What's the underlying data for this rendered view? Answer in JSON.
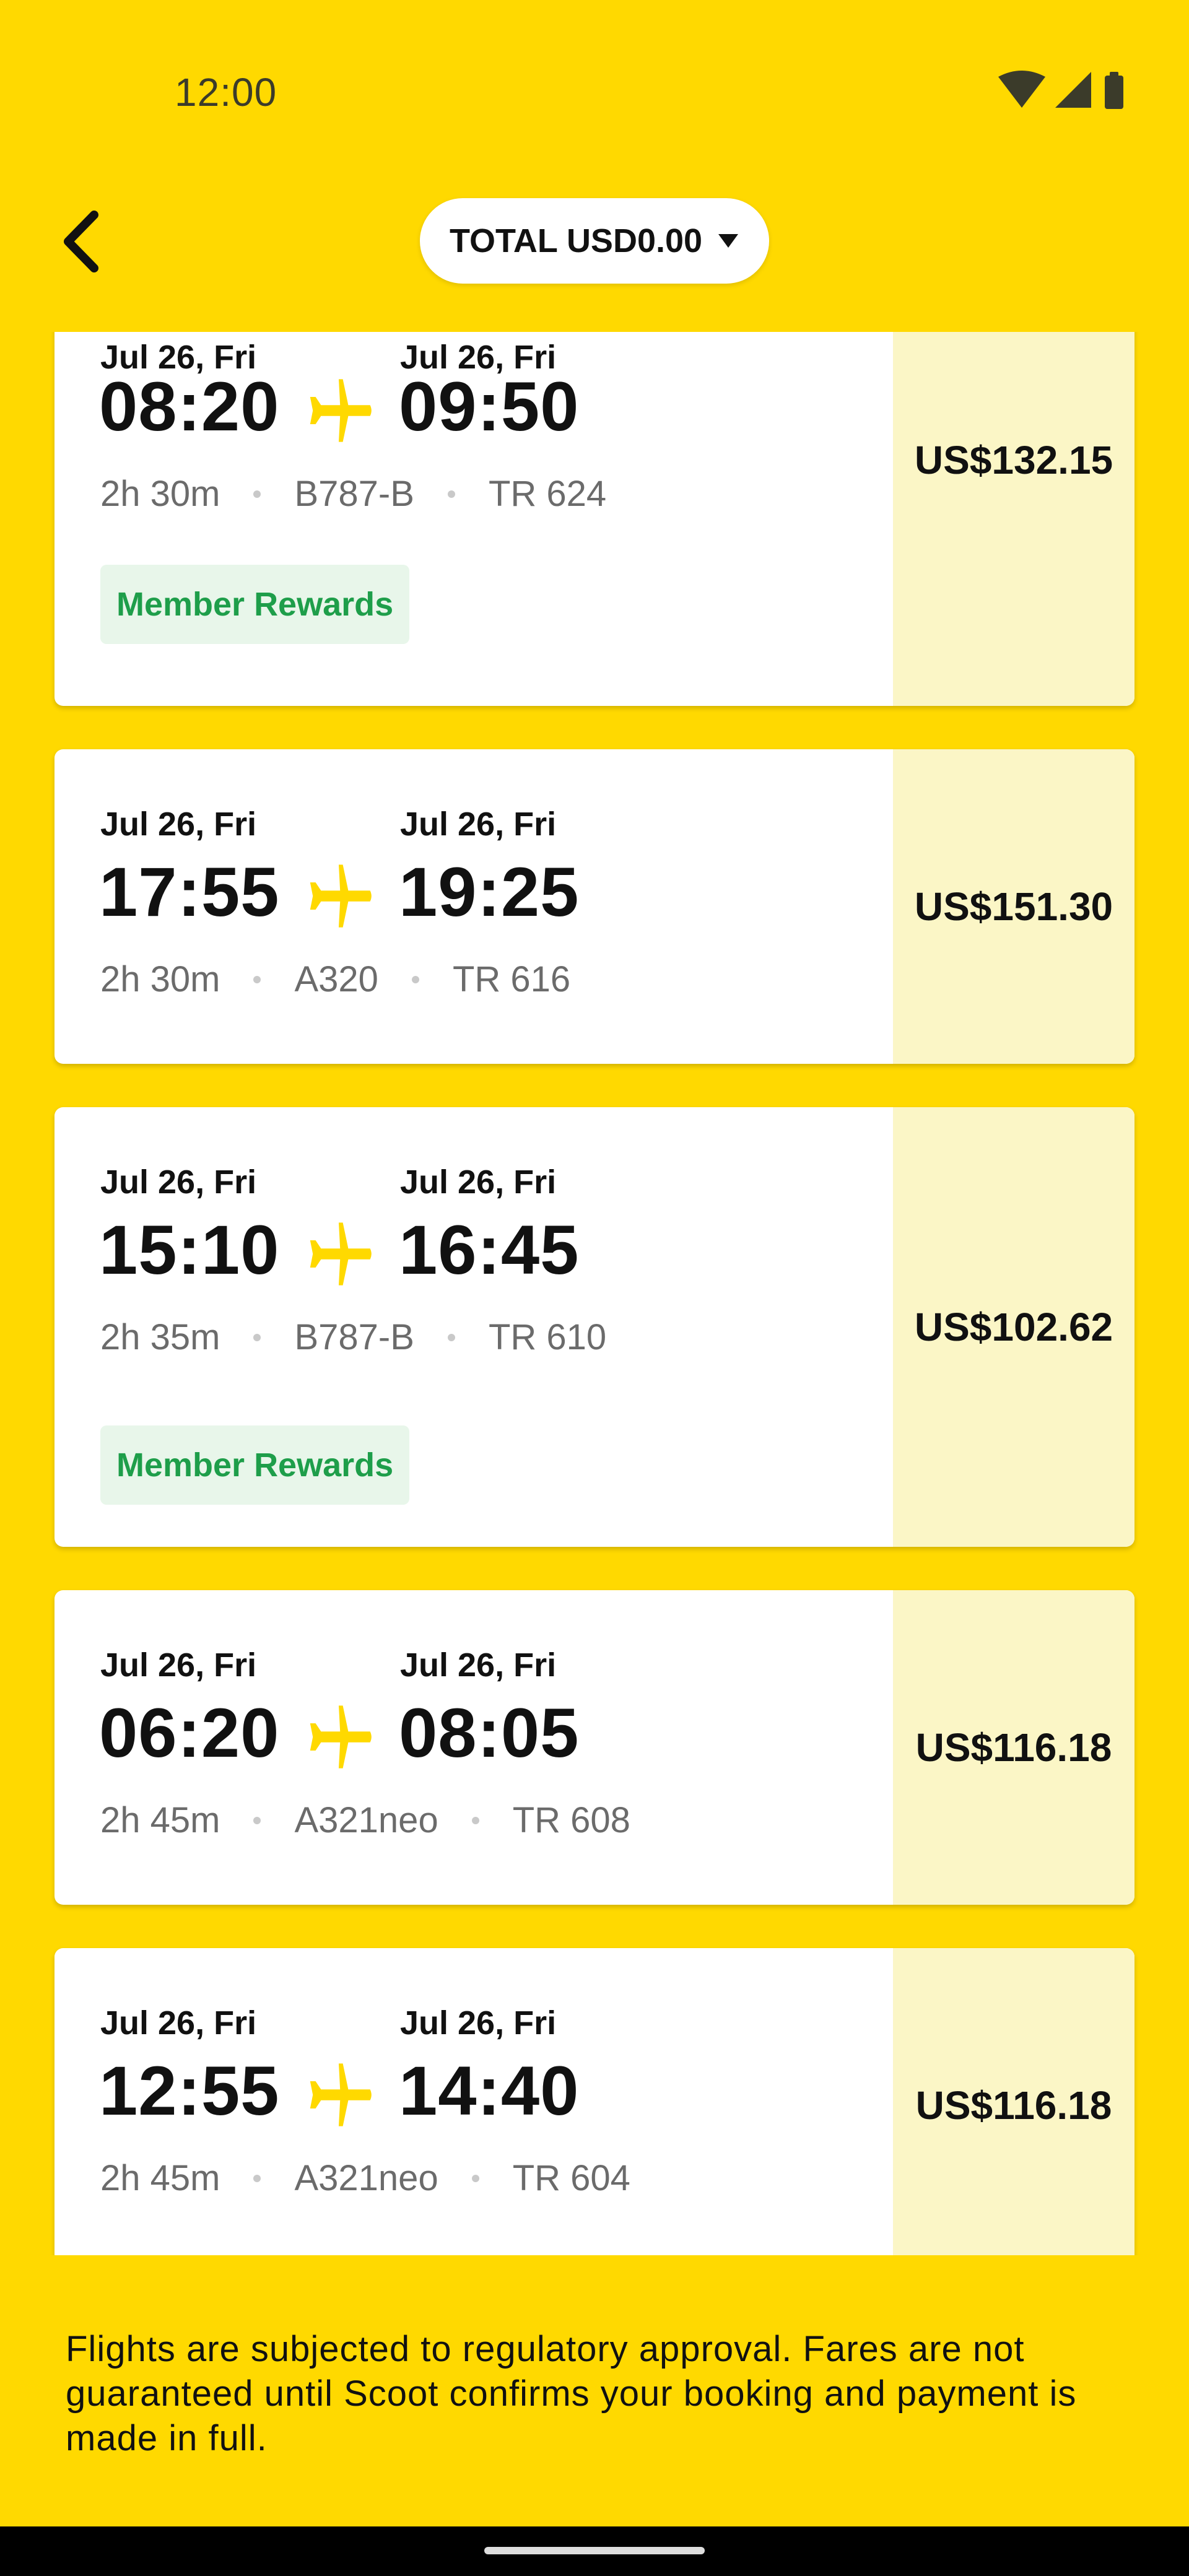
{
  "status_bar": {
    "time": "12:00",
    "icons": [
      "wifi-icon",
      "cellular-signal-icon",
      "battery-icon"
    ]
  },
  "header": {
    "back_icon": "chevron-left-icon",
    "total_label": "TOTAL USD0.00",
    "dropdown_icon": "caret-down-icon"
  },
  "flights": [
    {
      "depart_date": "Jul 26, Fri",
      "depart_time": "08:20",
      "arrive_date": "Jul 26, Fri",
      "arrive_time": "09:50",
      "duration": "2h 30m",
      "aircraft": "B787-B",
      "flight_no": "TR 624",
      "badge": "Member Rewards",
      "price": "US$132.15"
    },
    {
      "depart_date": "Jul 26, Fri",
      "depart_time": "17:55",
      "arrive_date": "Jul 26, Fri",
      "arrive_time": "19:25",
      "duration": "2h 30m",
      "aircraft": "A320",
      "flight_no": "TR 616",
      "badge": "",
      "price": "US$151.30"
    },
    {
      "depart_date": "Jul 26, Fri",
      "depart_time": "15:10",
      "arrive_date": "Jul 26, Fri",
      "arrive_time": "16:45",
      "duration": "2h 35m",
      "aircraft": "B787-B",
      "flight_no": "TR 610",
      "badge": "Member Rewards",
      "price": "US$102.62"
    },
    {
      "depart_date": "Jul 26, Fri",
      "depart_time": "06:20",
      "arrive_date": "Jul 26, Fri",
      "arrive_time": "08:05",
      "duration": "2h 45m",
      "aircraft": "A321neo",
      "flight_no": "TR 608",
      "badge": "",
      "price": "US$116.18"
    },
    {
      "depart_date": "Jul 26, Fri",
      "depart_time": "12:55",
      "arrive_date": "Jul 26, Fri",
      "arrive_time": "14:40",
      "duration": "2h 45m",
      "aircraft": "A321neo",
      "flight_no": "TR 604",
      "badge": "",
      "price": "US$116.18"
    }
  ],
  "disclaimer": "Flights are subjected to regulatory approval. Fares are not guaranteed until Scoot confirms your booking and payment is made in full.",
  "colors": {
    "brand_yellow": "#FFD900",
    "price_panel": "#FBF6C6",
    "badge_bg": "#E8F6EA",
    "badge_text": "#1E9E4A",
    "plane_icon": "#FFD900",
    "meta_text": "#6b6b6b"
  }
}
